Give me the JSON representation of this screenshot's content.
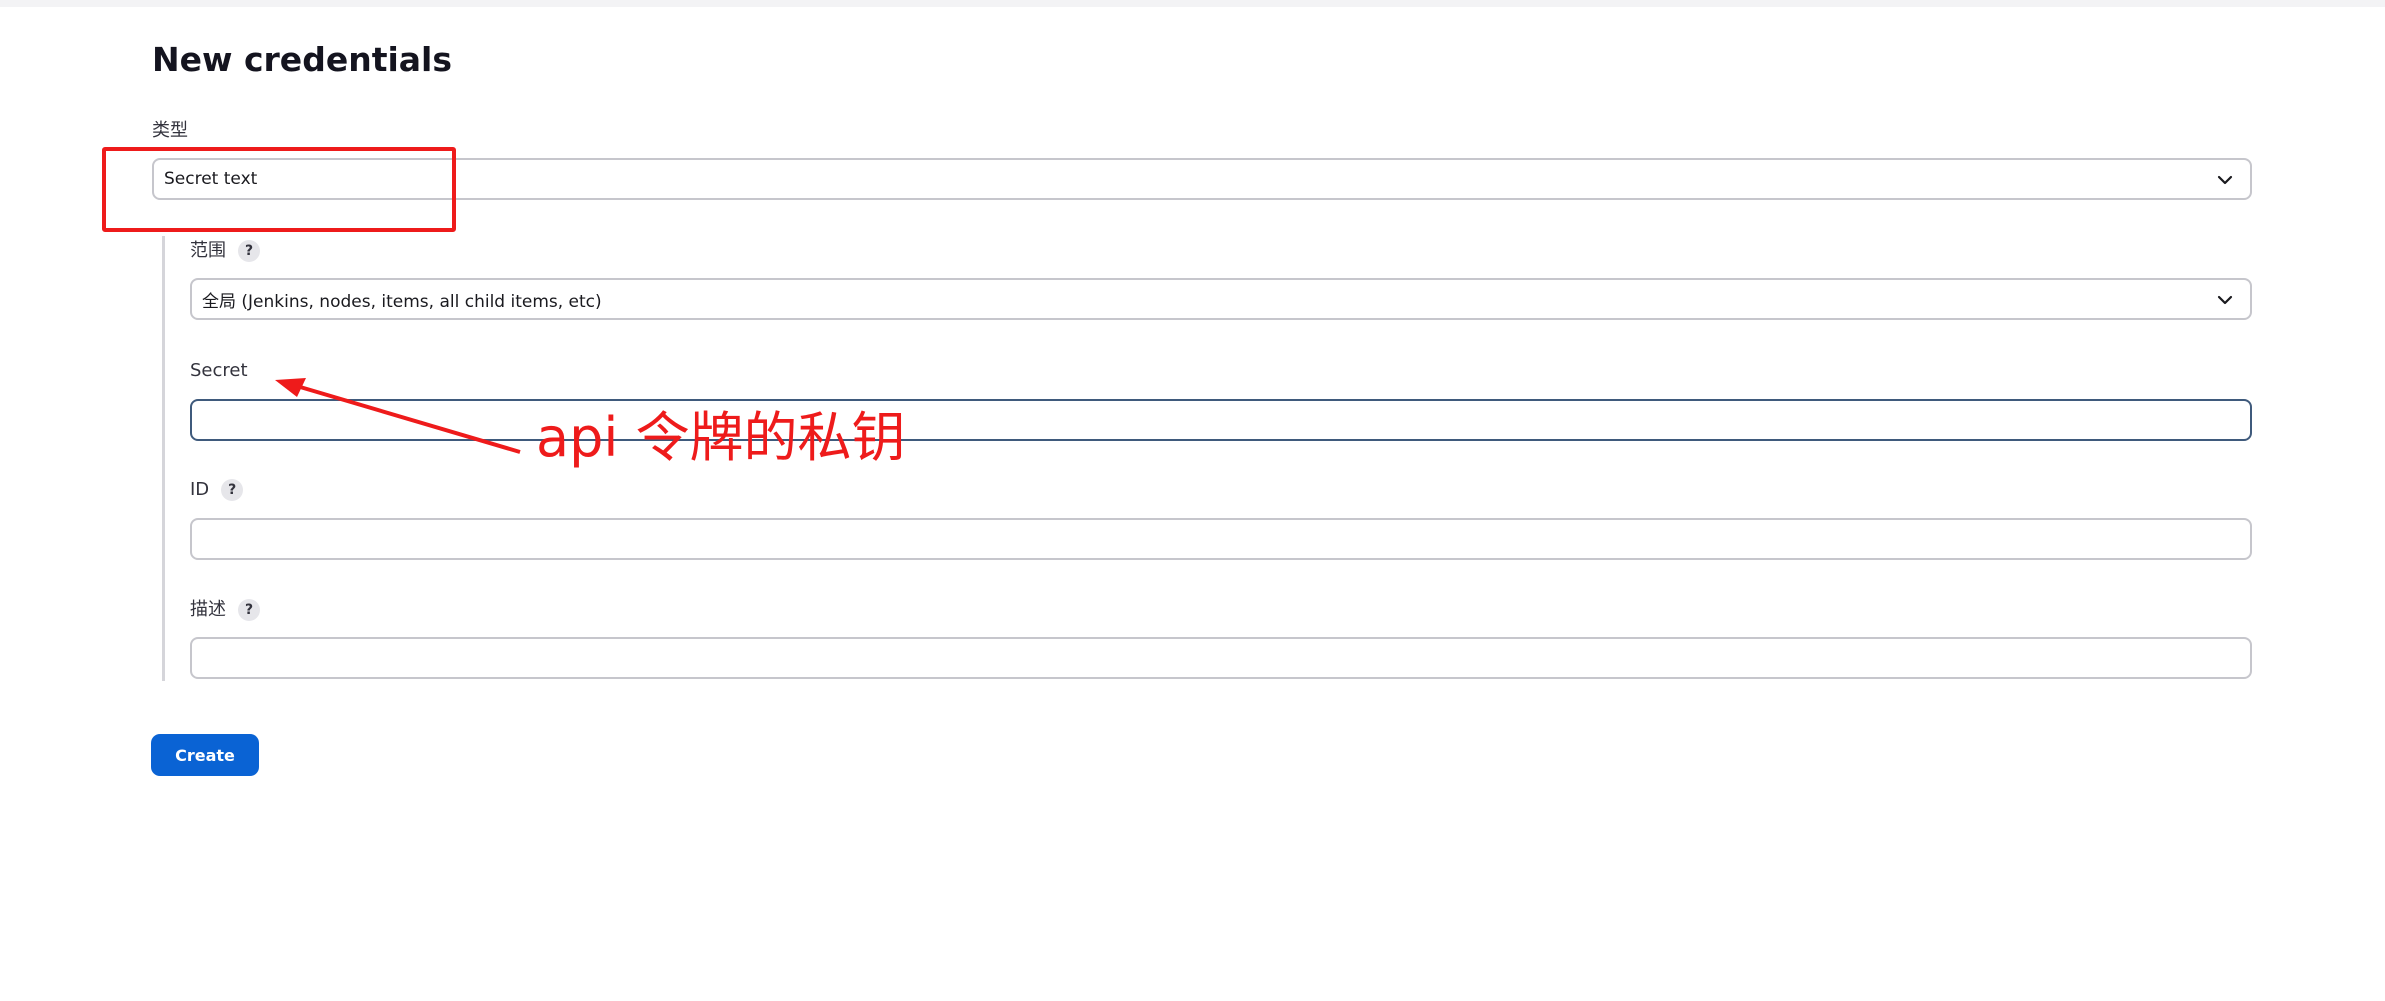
{
  "page": {
    "title": "New credentials"
  },
  "form": {
    "kind": {
      "label": "类型",
      "value": "Secret text"
    },
    "scope": {
      "label": "范围",
      "help": "?",
      "value": "全局 (Jenkins, nodes, items, all child items, etc)"
    },
    "secret": {
      "label": "Secret",
      "value": ""
    },
    "id": {
      "label": "ID",
      "help": "?",
      "value": ""
    },
    "description": {
      "label": "描述",
      "help": "?",
      "value": ""
    },
    "create_label": "Create"
  },
  "annotation": {
    "text": "api 令牌的私钥",
    "color": "#ee1b1b"
  },
  "colors": {
    "accent": "#0a63d4",
    "annotation": "#ee1b1b"
  },
  "icons": {
    "dropdown": "chevron-down-icon",
    "help": "question-icon"
  }
}
